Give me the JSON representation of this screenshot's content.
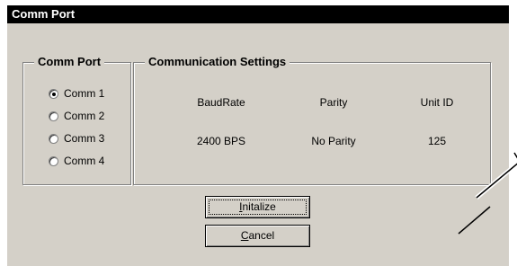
{
  "window": {
    "title": "Comm Port"
  },
  "comm_port_group": {
    "legend": "Comm Port",
    "options": [
      {
        "label": "Comm 1",
        "selected": true
      },
      {
        "label": "Comm 2",
        "selected": false
      },
      {
        "label": "Comm 3",
        "selected": false
      },
      {
        "label": "Comm 4",
        "selected": false
      }
    ]
  },
  "settings_group": {
    "legend": "Communication Settings",
    "headers": [
      "BaudRate",
      "Parity",
      "Unit ID"
    ],
    "values": [
      "2400 BPS",
      "No Parity",
      "125"
    ]
  },
  "buttons": {
    "initialize": {
      "prefix": "",
      "accel": "I",
      "rest": "nitalize"
    },
    "cancel": {
      "prefix": "",
      "accel": "C",
      "rest": "ancel"
    }
  }
}
